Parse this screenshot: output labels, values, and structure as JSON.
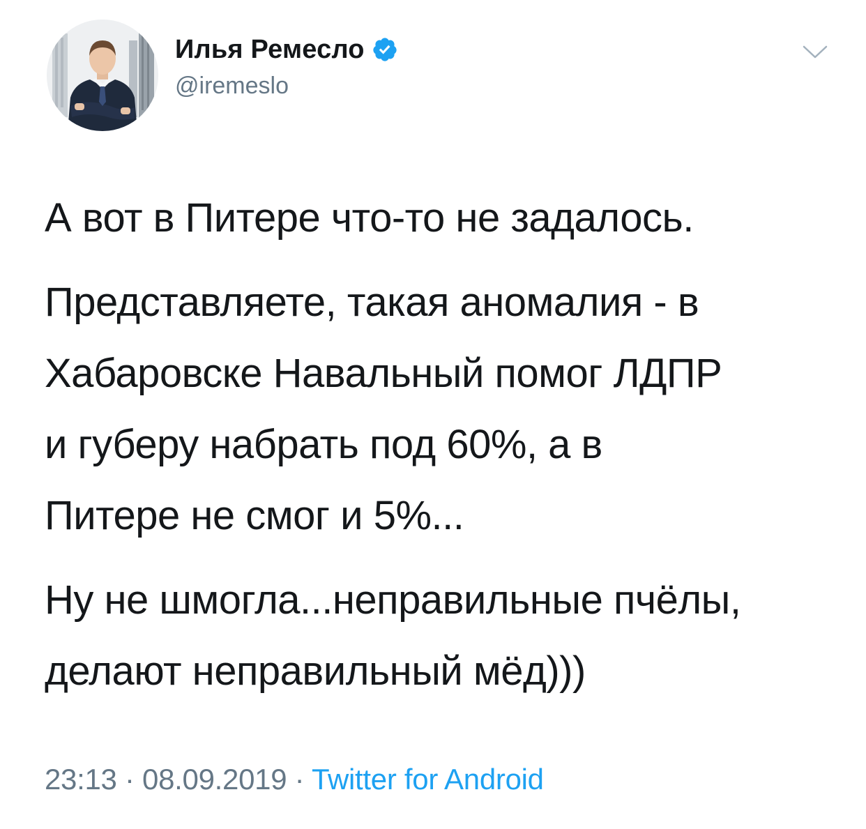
{
  "author": {
    "display_name": "Илья Ремесло",
    "handle": "@iremeslo",
    "verified": true,
    "avatar_icon": "person-avatar"
  },
  "tweet": {
    "paragraphs": [
      "А вот в Питере что-то не задалось.",
      "Представляете, такая аномалия - в\nХабаровске Навальный помог ЛДПР\nи губеру набрать под 60%, а в\nПитере не смог и 5%...",
      "Ну не шмогла...неправильные пчёлы,\nделают неправильный мёд)))"
    ]
  },
  "meta": {
    "time": "23:13",
    "separator": " · ",
    "date": "08.09.2019",
    "source": "Twitter for Android"
  },
  "colors": {
    "text": "#14171a",
    "secondary": "#657786",
    "accent": "#1da1f2"
  }
}
